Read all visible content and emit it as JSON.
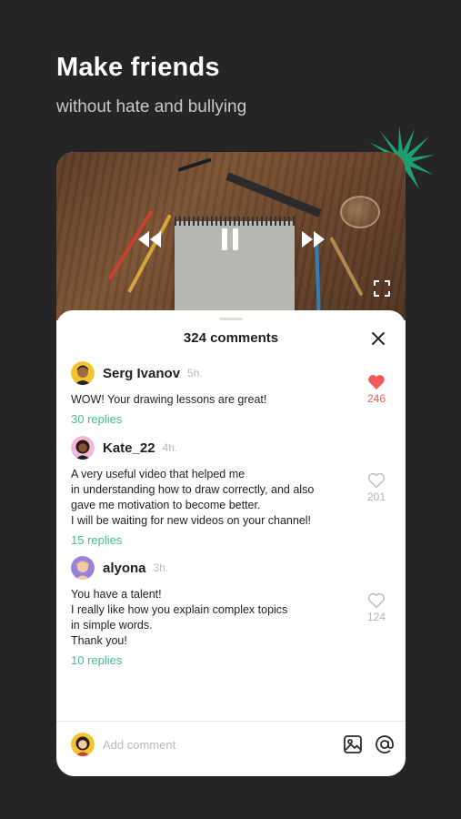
{
  "hero": {
    "title": "Make friends",
    "subtitle": "without hate and bullying"
  },
  "video": {
    "controls": [
      "rewind-icon",
      "pause-icon",
      "fast-forward-icon",
      "fullscreen-icon"
    ]
  },
  "comments_panel": {
    "count_label": "324 comments",
    "close_icon": "close-icon",
    "comments": [
      {
        "author": "Serg Ivanov",
        "time": "5h.",
        "text": "WOW! Your drawing lessons are great!",
        "replies": "30 replies",
        "likes": "246",
        "liked": true
      },
      {
        "author": "Kate_22",
        "time": "4h.",
        "text": "A very useful video that helped me\nin understanding how to draw correctly, and also\ngave me motivation to become better.\nI will be waiting for new videos on your channel!",
        "replies": "15 replies",
        "likes": "201",
        "liked": false
      },
      {
        "author": "alyona",
        "time": "3h.",
        "text": "You have a talent!\nI really like how you explain complex topics\nin simple words.\nThank you!",
        "replies": "10 replies",
        "likes": "124",
        "liked": false
      }
    ]
  },
  "composer": {
    "placeholder": "Add comment",
    "buttons": [
      "image-icon",
      "at-sign-icon"
    ]
  },
  "colors": {
    "background": "#252527",
    "accent_green": "#3fbf8f",
    "like_red": "#f05a5a",
    "starburst": "#1f9e72"
  }
}
